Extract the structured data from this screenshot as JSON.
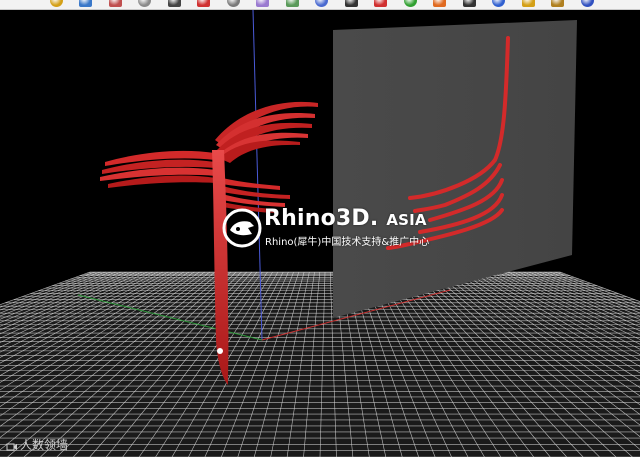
{
  "toolbar": {
    "buttons": [
      {
        "icon": "mesh-icon",
        "color": "#d4a017"
      },
      {
        "icon": "rotate-icon",
        "color": "#3a78c9"
      },
      {
        "icon": "pan-icon",
        "color": "#c05050"
      },
      {
        "icon": "zoom-icon",
        "color": "#8a8a8a"
      },
      {
        "icon": "grid-icon",
        "color": "#444444"
      },
      {
        "icon": "curve-icon",
        "color": "#d03030"
      },
      {
        "icon": "gumball-icon",
        "color": "#7a7a7a"
      },
      {
        "icon": "transform-icon",
        "color": "#9a7ad0"
      },
      {
        "icon": "snap-icon",
        "color": "#5a9a5a"
      },
      {
        "icon": "filter-icon",
        "color": "#4a6ad0"
      },
      {
        "icon": "layer-icon",
        "color": "#333333"
      },
      {
        "icon": "properties-icon",
        "color": "#d03030"
      },
      {
        "icon": "render-icon",
        "color": "#30a030"
      },
      {
        "icon": "material-icon",
        "color": "#e06a20"
      },
      {
        "icon": "sphere-icon",
        "color": "#333333"
      },
      {
        "icon": "environment-icon",
        "color": "#3060d0"
      },
      {
        "icon": "light-icon",
        "color": "#d4a017"
      },
      {
        "icon": "settings-icon",
        "color": "#b08020"
      },
      {
        "icon": "help-icon",
        "color": "#3050c0"
      }
    ]
  },
  "watermark": {
    "title_main": "Rhino3D.",
    "title_suffix": "ASIA",
    "subtitle": "Rhino(犀牛)中国技术支持&推广中心"
  },
  "viewport": {
    "label": "人数领墙"
  },
  "colors": {
    "background": "#000000",
    "grid": "#d8d8d8",
    "ground_plane": "#3a3a3a",
    "model": "#d32a2a",
    "z_axis": "#4a5ad8",
    "x_axis": "#c83232",
    "y_axis": "#2e9a3a"
  }
}
